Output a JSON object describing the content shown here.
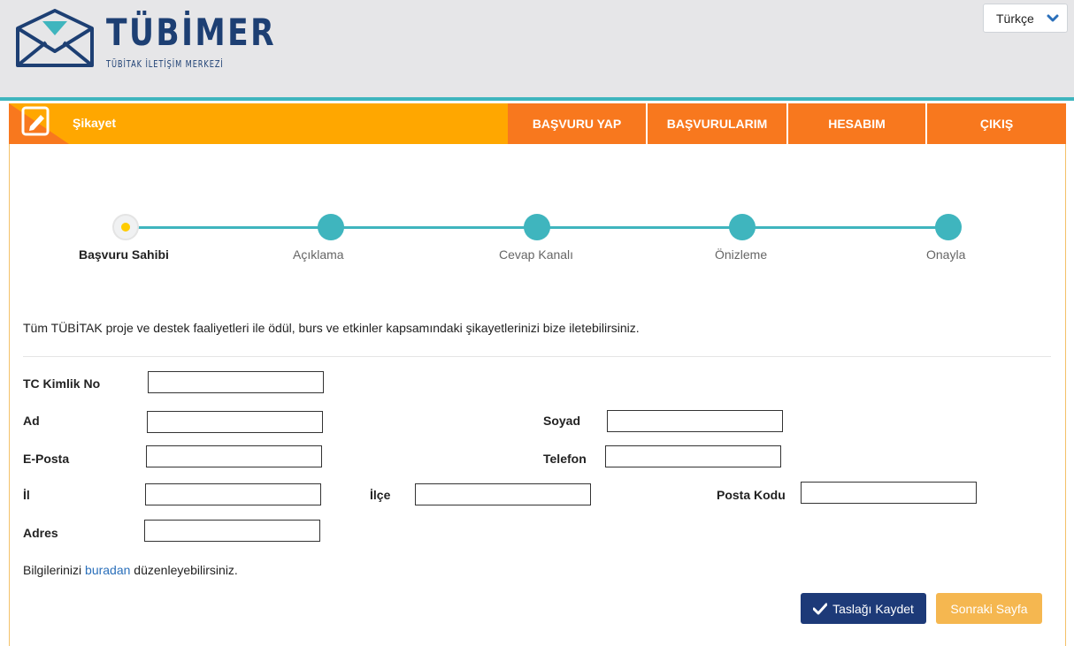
{
  "brand": {
    "title": "TÜBİMER",
    "subtitle": "TÜBİTAK İLETİŞİM MERKEZİ"
  },
  "language": {
    "selected": "Türkçe"
  },
  "nav": {
    "section_title": "Şikayet",
    "items": [
      "BAŞVURU YAP",
      "BAŞVURULARIM",
      "HESABIM",
      "ÇIKIŞ"
    ]
  },
  "stepper": {
    "steps": [
      "Başvuru Sahibi",
      "Açıklama",
      "Cevap Kanalı",
      "Önizleme",
      "Onayla"
    ],
    "active_index": 0
  },
  "intro_text": "Tüm TÜBİTAK proje ve destek faaliyetleri ile ödül, burs ve etkinler kapsamındaki şikayetlerinizi bize iletebilirsiniz.",
  "form": {
    "tc_label": "TC Kimlik No",
    "ad_label": "Ad",
    "soyad_label": "Soyad",
    "eposta_label": "E-Posta",
    "telefon_label": "Telefon",
    "il_label": "İl",
    "ilce_label": "İlçe",
    "posta_kodu_label": "Posta Kodu",
    "adres_label": "Adres",
    "values": {
      "tc": "",
      "ad": "",
      "soyad": "",
      "eposta": "",
      "telefon": "",
      "il": "",
      "ilce": "",
      "posta_kodu": "",
      "adres": ""
    }
  },
  "info": {
    "prefix": "Bilgilerinizi ",
    "link": "buradan",
    "suffix": " düzenleyebilirsiniz."
  },
  "buttons": {
    "save_draft": "Taslağı Kaydet",
    "next_page": "Sonraki Sayfa"
  },
  "colors": {
    "brand_navy": "#1d3f73",
    "accent_orange": "#ffa700",
    "menu_orange": "#f8781e",
    "teal": "#3fb5be",
    "save_button": "#1d3a78",
    "next_button": "#f5b750"
  }
}
